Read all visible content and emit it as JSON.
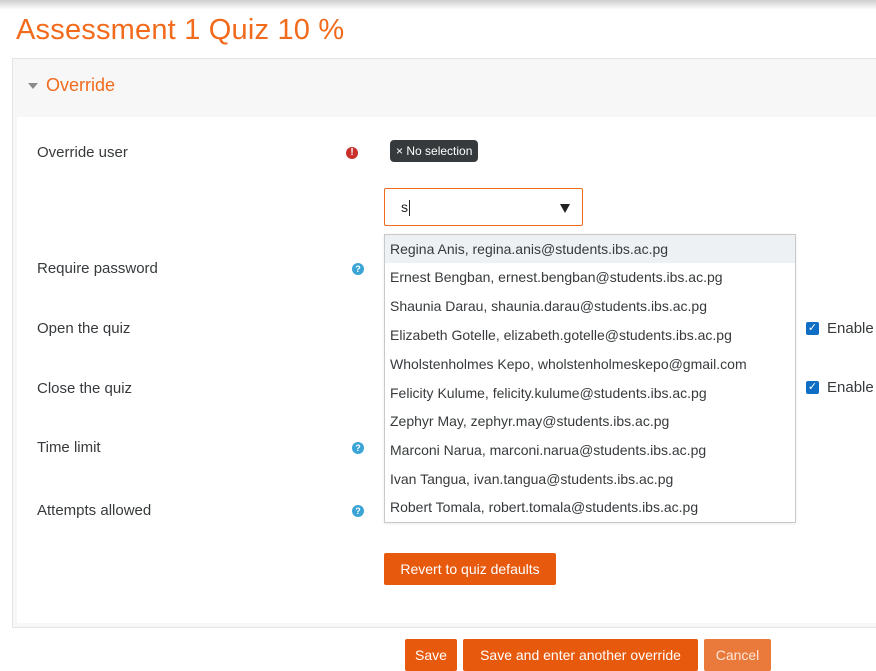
{
  "page": {
    "title": "Assessment 1 Quiz 10 %"
  },
  "section": {
    "legend": "Override"
  },
  "fields": {
    "override_user": "Override user",
    "require_password": "Require password",
    "open_quiz": "Open the quiz",
    "close_quiz": "Close the quiz",
    "time_limit": "Time limit",
    "attempts_allowed": "Attempts allowed"
  },
  "selection_badge": "× No selection",
  "search": {
    "value": "s"
  },
  "options": [
    "Regina Anis, regina.anis@students.ibs.ac.pg",
    "Ernest Bengban, ernest.bengban@students.ibs.ac.pg",
    "Shaunia Darau, shaunia.darau@students.ibs.ac.pg",
    "Elizabeth Gotelle, elizabeth.gotelle@students.ibs.ac.pg",
    "Wholstenholmes Kepo, wholstenholmeskepo@gmail.com",
    "Felicity Kulume, felicity.kulume@students.ibs.ac.pg",
    "Zephyr May, zephyr.may@students.ibs.ac.pg",
    "Marconi Narua, marconi.narua@students.ibs.ac.pg",
    "Ivan Tangua, ivan.tangua@students.ibs.ac.pg",
    "Robert Tomala, robert.tomala@students.ibs.ac.pg"
  ],
  "enable_label": "Enable",
  "buttons": {
    "revert": "Revert to quiz defaults",
    "save": "Save",
    "save_another": "Save and enter another override",
    "cancel": "Cancel"
  },
  "colors": {
    "accent": "#f26b1d",
    "button": "#e7590c",
    "required_icon": "#c9302c",
    "help_icon": "#3aa4d6",
    "checkbox": "#0f6fc5"
  },
  "icons": {
    "required": "exclamation-circle",
    "help": "question-circle",
    "collapse": "caret-down"
  }
}
